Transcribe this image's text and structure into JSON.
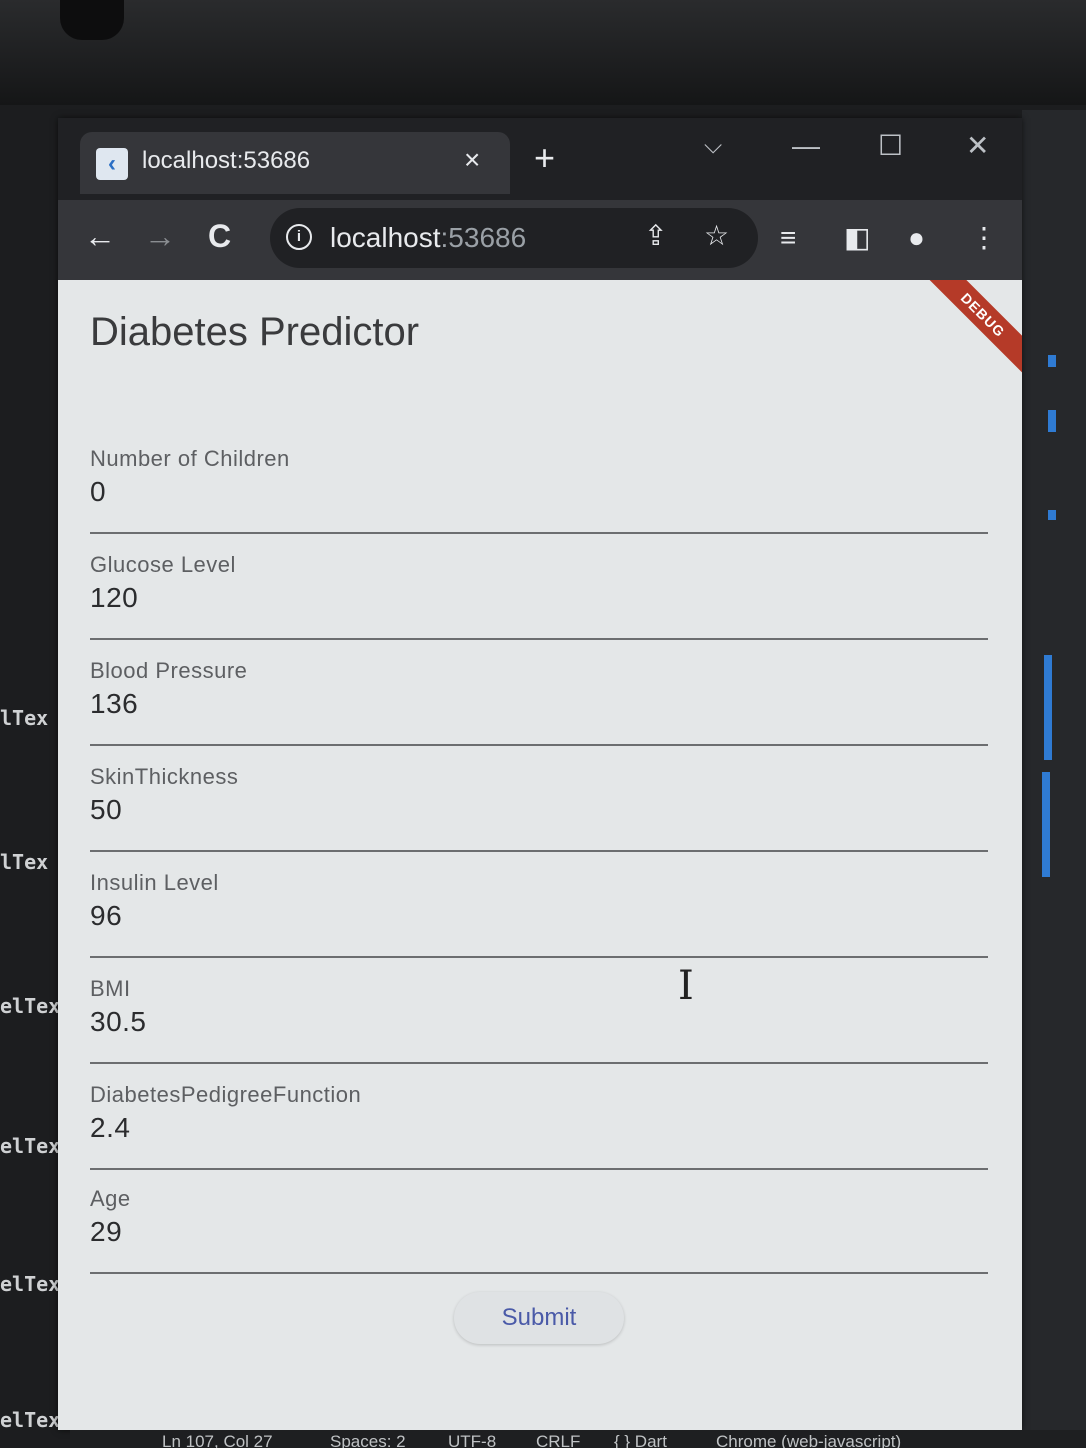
{
  "editor_fragments": [
    "lTex",
    "lTex",
    "elTex",
    "elTex",
    "elTex",
    "elTex"
  ],
  "tab": {
    "title": "localhost:53686",
    "close_icon": "×",
    "new_tab_icon": "+"
  },
  "window_controls": {
    "dropdown": "⌵",
    "minimize": "—",
    "maximize": "☐",
    "close": "✕"
  },
  "toolbar": {
    "back": "←",
    "forward": "→",
    "reload": "C",
    "url_host": "localhost",
    "url_port": ":53686",
    "share_icon": "⇪",
    "star_icon": "☆",
    "media_icon": "≡",
    "sidepanel_icon": "◧",
    "profile_icon": "●",
    "menu_icon": "⋮"
  },
  "app": {
    "debug_banner": "DEBUG",
    "title": "Diabetes Predictor",
    "fields": [
      {
        "label": "Number of Children",
        "value": "0"
      },
      {
        "label": "Glucose Level",
        "value": "120"
      },
      {
        "label": "Blood Pressure",
        "value": "136"
      },
      {
        "label": "SkinThickness",
        "value": "50"
      },
      {
        "label": "Insulin Level",
        "value": "96"
      },
      {
        "label": "BMI",
        "value": "30.5"
      },
      {
        "label": "DiabetesPedigreeFunction",
        "value": "2.4"
      },
      {
        "label": "Age",
        "value": "29"
      }
    ],
    "submit_label": "Submit"
  },
  "statusbar": {
    "position": "Ln 107, Col 27",
    "spaces": "Spaces: 2",
    "encoding": "UTF-8",
    "eol": "CRLF",
    "language": "{ } Dart",
    "device": "Chrome (web-javascript)"
  },
  "colors": {
    "accent": "#4a5aa8",
    "debug": "#b53a28",
    "viewport_bg": "#e4e7e8"
  }
}
